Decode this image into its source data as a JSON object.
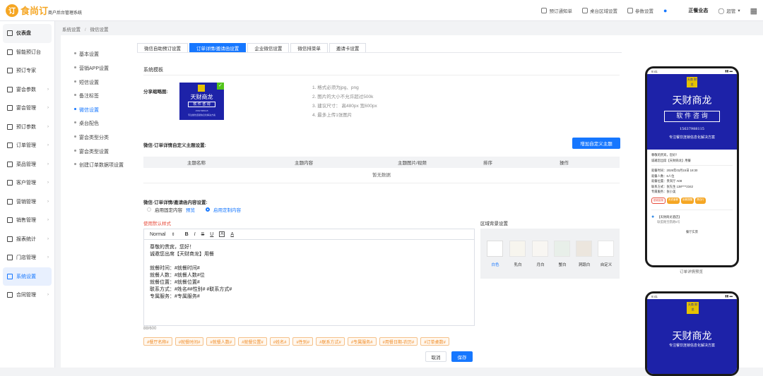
{
  "brand": {
    "name": "食尚订",
    "subtitle": "商户后台管理系统"
  },
  "topbar": {
    "items": [
      {
        "label": "预订通知单",
        "icon": "bell-list-icon"
      },
      {
        "label": "桌台区域设置",
        "icon": "table-icon"
      },
      {
        "label": "参数设置",
        "icon": "gear-icon"
      }
    ],
    "org": "正餐业态",
    "user": "超管"
  },
  "sidebar": [
    {
      "label": "仪表盘",
      "icon": "dashboard-icon"
    },
    {
      "label": "智能预订台",
      "icon": "monitor-icon"
    },
    {
      "label": "预订专家",
      "icon": "laptop-icon"
    },
    {
      "label": "宴会参数",
      "icon": "banquet-icon"
    },
    {
      "label": "宴会管理",
      "icon": "banquet-manage-icon"
    },
    {
      "label": "预订参数",
      "icon": "calendar-icon"
    },
    {
      "label": "订单管理",
      "icon": "order-icon"
    },
    {
      "label": "菜品管理",
      "icon": "dish-icon"
    },
    {
      "label": "客户管理",
      "icon": "customer-icon"
    },
    {
      "label": "营销管理",
      "icon": "marketing-icon"
    },
    {
      "label": "销售管理",
      "icon": "sales-icon"
    },
    {
      "label": "报表统计",
      "icon": "report-icon"
    },
    {
      "label": "门店管理",
      "icon": "store-icon"
    },
    {
      "label": "系统设置",
      "icon": "settings-icon"
    },
    {
      "label": "合同管理",
      "icon": "contract-icon"
    }
  ],
  "breadcrumb": {
    "parent": "系统设置",
    "sep": "/",
    "current": "微信设置"
  },
  "subnav": [
    "基本设置",
    "营销APP设置",
    "短信设置",
    "备注标签",
    "微信设置",
    "桌台配色",
    "宴会类型分类",
    "宴会类型设置",
    "创建订单数据项设置"
  ],
  "tabs": [
    "微信自助预订设置",
    "订单详情/邀请函设置",
    "企业微信设置",
    "微信排菜单",
    "邀请卡设置"
  ],
  "section": {
    "title": "系统模板",
    "share_label": "分享缩略图:",
    "rules": [
      "1. 格式必须为jpg、png",
      "2. 图片的大小不允许超过500k",
      "3. 建议尺寸： 高480px 宽600px",
      "4. 最多上传1张图片"
    ]
  },
  "thumb": {
    "title": "天财商龙",
    "box": "软 件 咨 询",
    "phone": "15637988115",
    "slogan": "专注餐饮连锁信息化解决方案"
  },
  "theme": {
    "label": "微信-订单详情自定义主题设置:",
    "add_button": "增加自定义主题",
    "columns": [
      "主题名称",
      "主题内容",
      "主题图片/视频",
      "排序",
      "操作"
    ],
    "empty": "暂无数据"
  },
  "content": {
    "label": "微信-订单详情/邀请函内容设置:",
    "option_fixed": "启用固定内容",
    "preview": "预览",
    "option_custom": "启用定制内容",
    "default_style": "使用默认样式"
  },
  "editor": {
    "font": "Normal",
    "lines": [
      "尊敬的贵宾，您好！",
      "诚邀您出席【天财商龙】用餐",
      "",
      "就餐时间：#就餐时间#",
      "就餐人数：#就餐人数#位",
      "就餐位置：#就餐位置#",
      "联系方式：#姓名##性别# #联系方式#",
      "专属服务：#专属服务#"
    ],
    "count": "88/600"
  },
  "tags": [
    "#餐厅名称#",
    "#就餐时间#",
    "#就餐人数#",
    "#就餐位置#",
    "#姓名#",
    "#性别#",
    "#联系方式#",
    "#专属服务#",
    "#用餐日期-农历#",
    "#订单桌数#"
  ],
  "background": {
    "title": "区域背景设置",
    "swatches": [
      {
        "label": "白色",
        "color": "#ffffff"
      },
      {
        "label": "乳白",
        "color": "#f7f5ee"
      },
      {
        "label": "月白",
        "color": "#f8f6f2"
      },
      {
        "label": "蟹白",
        "color": "#e8efe9"
      },
      {
        "label": "洞䟗白",
        "color": "#ece6de"
      },
      {
        "label": "自定义",
        "color": "#ffffff"
      }
    ]
  },
  "buttons": {
    "cancel": "取消",
    "save": "保存"
  },
  "preview": {
    "time": "9:41",
    "seal": "天商\n财龙",
    "title": "天财商龙",
    "box": "软 件 咨 询",
    "phone": "15637988115",
    "slogan": "专注餐饮连锁信息化解决方案",
    "lines": [
      "尊敬的贵宾，您好！",
      "诚邀您出席【天财商龙】用餐",
      "就餐时间：2026年03月15日 18:30",
      "就餐人数：6人位",
      "就餐位置：贵宾厅 A08",
      "联系方式：张先生 138****2342",
      "专属服务：张小美"
    ],
    "tags": [
      "银城宴席",
      "贵宾套餐",
      "用餐提醒",
      "漂泊行"
    ],
    "store": "【天财商龙酒店】",
    "address": "联盟路宝鼎路5号",
    "bottom": "餐厅实景",
    "caption": "订单详情预览",
    "title2": "天财商龙",
    "slogan2": "专注餐饮连锁信息化解决方案"
  }
}
